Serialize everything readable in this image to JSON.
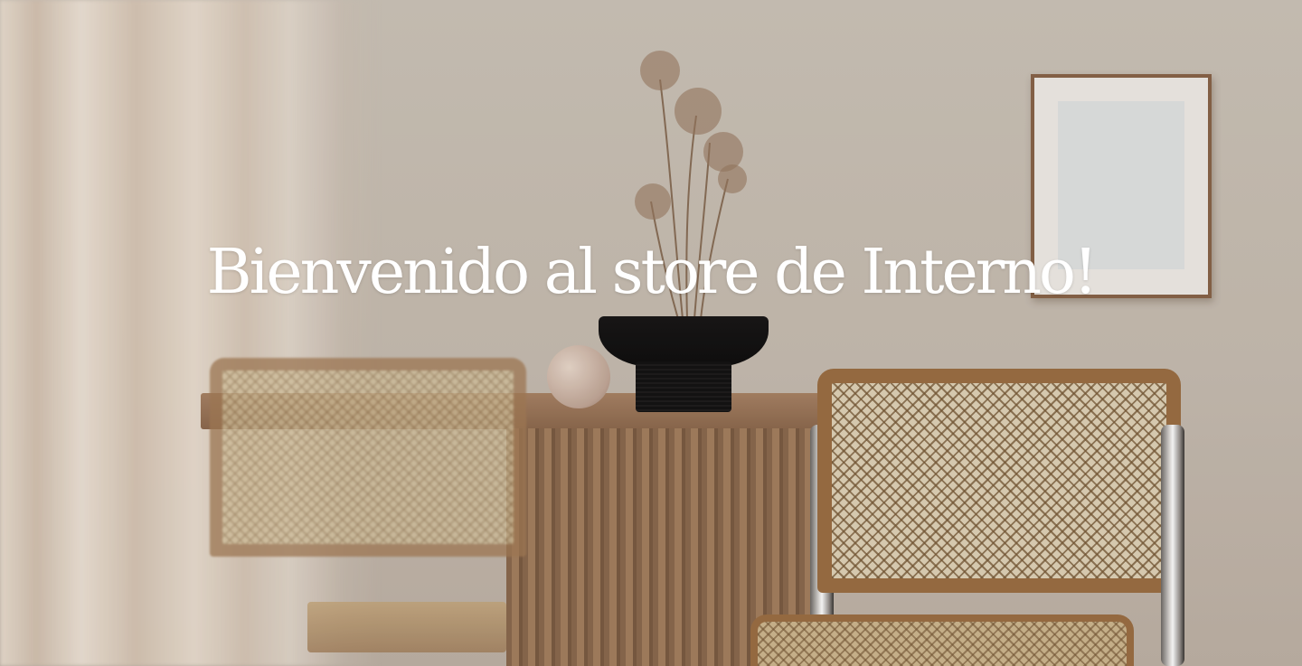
{
  "hero": {
    "title": "Bienvenido al store de Interno!"
  },
  "colors": {
    "title": "#ffffff",
    "wall": "#c9bfb3",
    "wood": "#9c6f44",
    "bowl": "#141313"
  }
}
